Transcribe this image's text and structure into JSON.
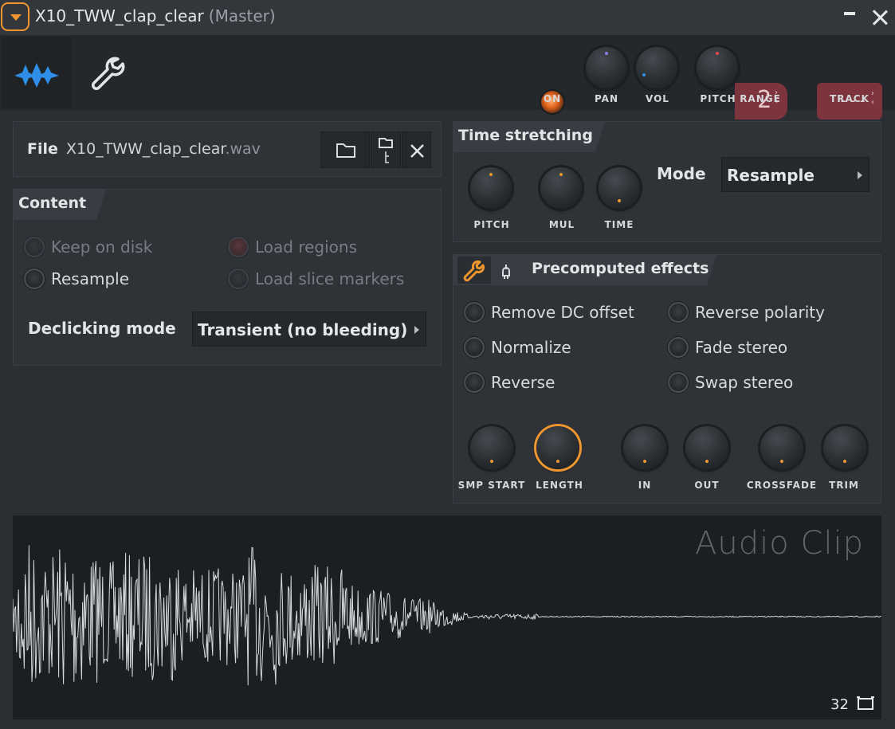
{
  "window": {
    "title": "X10_TWW_clap_clear",
    "subtitle": "(Master)"
  },
  "toolbar": {
    "on_label": "ON",
    "pan_label": "PAN",
    "vol_label": "VOL",
    "pitch_label": "PITCH",
    "range_label": "RANGE",
    "range_value": "2",
    "track_label": "TRACK",
    "track_value": "---"
  },
  "file": {
    "label": "File",
    "name": "X10_TWW_clap_clear",
    "ext": ".wav"
  },
  "content": {
    "title": "Content",
    "keep_on_disk": "Keep on disk",
    "load_regions": "Load regions",
    "resample": "Resample",
    "load_slice_markers": "Load slice markers",
    "declicking_label": "Declicking mode",
    "declicking_value": "Transient (no bleeding)"
  },
  "time_stretching": {
    "title": "Time stretching",
    "pitch_label": "PITCH",
    "mul_label": "MUL",
    "time_label": "TIME",
    "mode_label": "Mode",
    "mode_value": "Resample"
  },
  "effects": {
    "title": "Precomputed effects",
    "remove_dc": "Remove DC offset",
    "reverse_polarity": "Reverse polarity",
    "normalize": "Normalize",
    "fade_stereo": "Fade stereo",
    "reverse": "Reverse",
    "swap_stereo": "Swap stereo",
    "knobs": {
      "smp_start": "SMP START",
      "length": "LENGTH",
      "in": "IN",
      "out": "OUT",
      "crossfade": "CROSSFADE",
      "trim": "TRIM"
    }
  },
  "waveform": {
    "title": "Audio Clip",
    "zoom": "32"
  },
  "colors": {
    "accent_orange": "#f0962e",
    "accent_blue": "#2f8fe8",
    "track_red": "#7d343d",
    "background": "#2b2f34"
  }
}
